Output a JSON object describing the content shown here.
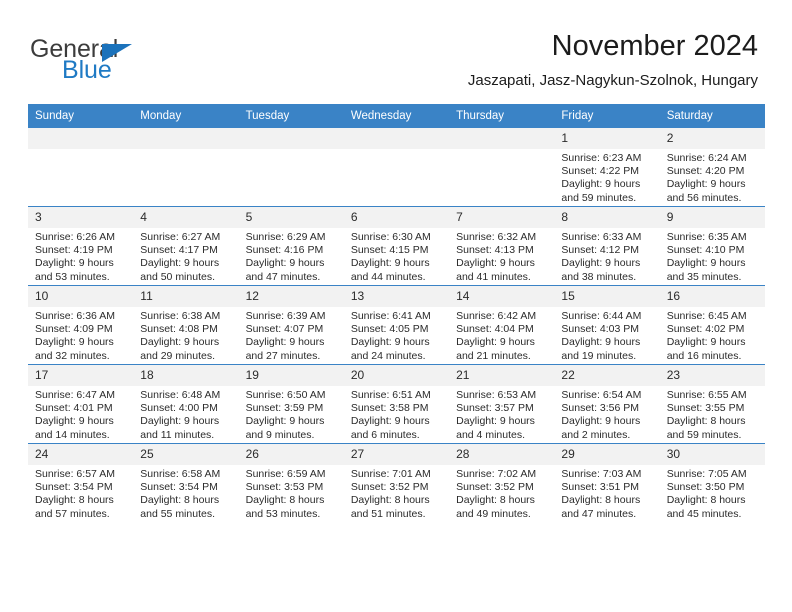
{
  "brand": {
    "name_top": "General",
    "name_bottom": "Blue",
    "triangle_icon": "triangle-icon",
    "accent_color": "#1b72bb"
  },
  "header": {
    "title": "November 2024",
    "subtitle": "Jaszapati, Jasz-Nagykun-Szolnok, Hungary"
  },
  "colors": {
    "header_blue": "#3a83c6",
    "daynum_band": "#f2f2f2",
    "text": "#2b2b2b"
  },
  "weekday_headers": [
    "Sunday",
    "Monday",
    "Tuesday",
    "Wednesday",
    "Thursday",
    "Friday",
    "Saturday"
  ],
  "weeks": [
    [
      {
        "day": "",
        "sunrise": "",
        "sunset": "",
        "daylight_line1": "",
        "daylight_line2": ""
      },
      {
        "day": "",
        "sunrise": "",
        "sunset": "",
        "daylight_line1": "",
        "daylight_line2": ""
      },
      {
        "day": "",
        "sunrise": "",
        "sunset": "",
        "daylight_line1": "",
        "daylight_line2": ""
      },
      {
        "day": "",
        "sunrise": "",
        "sunset": "",
        "daylight_line1": "",
        "daylight_line2": ""
      },
      {
        "day": "",
        "sunrise": "",
        "sunset": "",
        "daylight_line1": "",
        "daylight_line2": ""
      },
      {
        "day": "1",
        "sunrise": "Sunrise: 6:23 AM",
        "sunset": "Sunset: 4:22 PM",
        "daylight_line1": "Daylight: 9 hours",
        "daylight_line2": "and 59 minutes."
      },
      {
        "day": "2",
        "sunrise": "Sunrise: 6:24 AM",
        "sunset": "Sunset: 4:20 PM",
        "daylight_line1": "Daylight: 9 hours",
        "daylight_line2": "and 56 minutes."
      }
    ],
    [
      {
        "day": "3",
        "sunrise": "Sunrise: 6:26 AM",
        "sunset": "Sunset: 4:19 PM",
        "daylight_line1": "Daylight: 9 hours",
        "daylight_line2": "and 53 minutes."
      },
      {
        "day": "4",
        "sunrise": "Sunrise: 6:27 AM",
        "sunset": "Sunset: 4:17 PM",
        "daylight_line1": "Daylight: 9 hours",
        "daylight_line2": "and 50 minutes."
      },
      {
        "day": "5",
        "sunrise": "Sunrise: 6:29 AM",
        "sunset": "Sunset: 4:16 PM",
        "daylight_line1": "Daylight: 9 hours",
        "daylight_line2": "and 47 minutes."
      },
      {
        "day": "6",
        "sunrise": "Sunrise: 6:30 AM",
        "sunset": "Sunset: 4:15 PM",
        "daylight_line1": "Daylight: 9 hours",
        "daylight_line2": "and 44 minutes."
      },
      {
        "day": "7",
        "sunrise": "Sunrise: 6:32 AM",
        "sunset": "Sunset: 4:13 PM",
        "daylight_line1": "Daylight: 9 hours",
        "daylight_line2": "and 41 minutes."
      },
      {
        "day": "8",
        "sunrise": "Sunrise: 6:33 AM",
        "sunset": "Sunset: 4:12 PM",
        "daylight_line1": "Daylight: 9 hours",
        "daylight_line2": "and 38 minutes."
      },
      {
        "day": "9",
        "sunrise": "Sunrise: 6:35 AM",
        "sunset": "Sunset: 4:10 PM",
        "daylight_line1": "Daylight: 9 hours",
        "daylight_line2": "and 35 minutes."
      }
    ],
    [
      {
        "day": "10",
        "sunrise": "Sunrise: 6:36 AM",
        "sunset": "Sunset: 4:09 PM",
        "daylight_line1": "Daylight: 9 hours",
        "daylight_line2": "and 32 minutes."
      },
      {
        "day": "11",
        "sunrise": "Sunrise: 6:38 AM",
        "sunset": "Sunset: 4:08 PM",
        "daylight_line1": "Daylight: 9 hours",
        "daylight_line2": "and 29 minutes."
      },
      {
        "day": "12",
        "sunrise": "Sunrise: 6:39 AM",
        "sunset": "Sunset: 4:07 PM",
        "daylight_line1": "Daylight: 9 hours",
        "daylight_line2": "and 27 minutes."
      },
      {
        "day": "13",
        "sunrise": "Sunrise: 6:41 AM",
        "sunset": "Sunset: 4:05 PM",
        "daylight_line1": "Daylight: 9 hours",
        "daylight_line2": "and 24 minutes."
      },
      {
        "day": "14",
        "sunrise": "Sunrise: 6:42 AM",
        "sunset": "Sunset: 4:04 PM",
        "daylight_line1": "Daylight: 9 hours",
        "daylight_line2": "and 21 minutes."
      },
      {
        "day": "15",
        "sunrise": "Sunrise: 6:44 AM",
        "sunset": "Sunset: 4:03 PM",
        "daylight_line1": "Daylight: 9 hours",
        "daylight_line2": "and 19 minutes."
      },
      {
        "day": "16",
        "sunrise": "Sunrise: 6:45 AM",
        "sunset": "Sunset: 4:02 PM",
        "daylight_line1": "Daylight: 9 hours",
        "daylight_line2": "and 16 minutes."
      }
    ],
    [
      {
        "day": "17",
        "sunrise": "Sunrise: 6:47 AM",
        "sunset": "Sunset: 4:01 PM",
        "daylight_line1": "Daylight: 9 hours",
        "daylight_line2": "and 14 minutes."
      },
      {
        "day": "18",
        "sunrise": "Sunrise: 6:48 AM",
        "sunset": "Sunset: 4:00 PM",
        "daylight_line1": "Daylight: 9 hours",
        "daylight_line2": "and 11 minutes."
      },
      {
        "day": "19",
        "sunrise": "Sunrise: 6:50 AM",
        "sunset": "Sunset: 3:59 PM",
        "daylight_line1": "Daylight: 9 hours",
        "daylight_line2": "and 9 minutes."
      },
      {
        "day": "20",
        "sunrise": "Sunrise: 6:51 AM",
        "sunset": "Sunset: 3:58 PM",
        "daylight_line1": "Daylight: 9 hours",
        "daylight_line2": "and 6 minutes."
      },
      {
        "day": "21",
        "sunrise": "Sunrise: 6:53 AM",
        "sunset": "Sunset: 3:57 PM",
        "daylight_line1": "Daylight: 9 hours",
        "daylight_line2": "and 4 minutes."
      },
      {
        "day": "22",
        "sunrise": "Sunrise: 6:54 AM",
        "sunset": "Sunset: 3:56 PM",
        "daylight_line1": "Daylight: 9 hours",
        "daylight_line2": "and 2 minutes."
      },
      {
        "day": "23",
        "sunrise": "Sunrise: 6:55 AM",
        "sunset": "Sunset: 3:55 PM",
        "daylight_line1": "Daylight: 8 hours",
        "daylight_line2": "and 59 minutes."
      }
    ],
    [
      {
        "day": "24",
        "sunrise": "Sunrise: 6:57 AM",
        "sunset": "Sunset: 3:54 PM",
        "daylight_line1": "Daylight: 8 hours",
        "daylight_line2": "and 57 minutes."
      },
      {
        "day": "25",
        "sunrise": "Sunrise: 6:58 AM",
        "sunset": "Sunset: 3:54 PM",
        "daylight_line1": "Daylight: 8 hours",
        "daylight_line2": "and 55 minutes."
      },
      {
        "day": "26",
        "sunrise": "Sunrise: 6:59 AM",
        "sunset": "Sunset: 3:53 PM",
        "daylight_line1": "Daylight: 8 hours",
        "daylight_line2": "and 53 minutes."
      },
      {
        "day": "27",
        "sunrise": "Sunrise: 7:01 AM",
        "sunset": "Sunset: 3:52 PM",
        "daylight_line1": "Daylight: 8 hours",
        "daylight_line2": "and 51 minutes."
      },
      {
        "day": "28",
        "sunrise": "Sunrise: 7:02 AM",
        "sunset": "Sunset: 3:52 PM",
        "daylight_line1": "Daylight: 8 hours",
        "daylight_line2": "and 49 minutes."
      },
      {
        "day": "29",
        "sunrise": "Sunrise: 7:03 AM",
        "sunset": "Sunset: 3:51 PM",
        "daylight_line1": "Daylight: 8 hours",
        "daylight_line2": "and 47 minutes."
      },
      {
        "day": "30",
        "sunrise": "Sunrise: 7:05 AM",
        "sunset": "Sunset: 3:50 PM",
        "daylight_line1": "Daylight: 8 hours",
        "daylight_line2": "and 45 minutes."
      }
    ]
  ]
}
